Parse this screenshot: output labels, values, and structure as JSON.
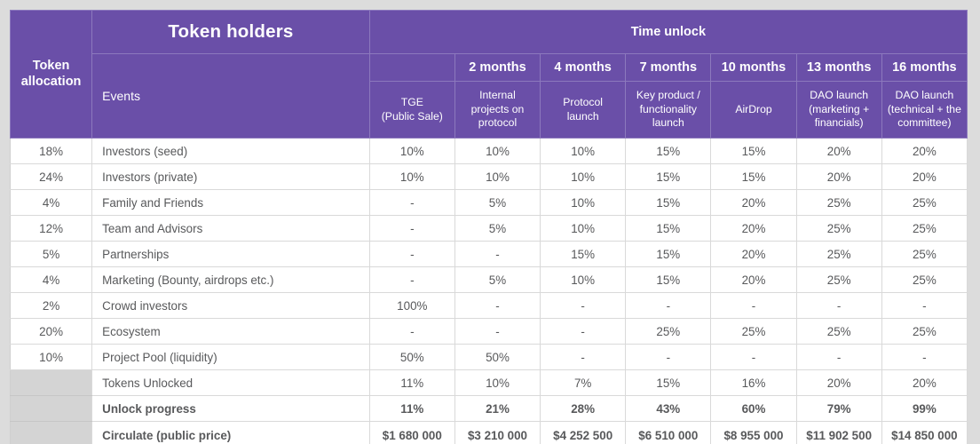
{
  "table": {
    "corner_header": "Token allocation",
    "holders_header": "Token holders",
    "events_header": "Events",
    "timeunlock_header": "Time unlock",
    "month_headers": [
      "",
      "2 months",
      "4 months",
      "7 months",
      "10 months",
      "13 months",
      "16 months"
    ],
    "event_descriptions": [
      "TGE\n(Public Sale)",
      "Internal projects on protocol",
      "Protocol launch",
      "Key product / functionality launch",
      "AirDrop",
      "DAO launch (marketing + financials)",
      "DAO launch (technical + the committee)"
    ],
    "event_desc_lines": [
      [
        "TGE",
        "(Public Sale)"
      ],
      [
        "Internal",
        "projects on",
        "protocol"
      ],
      [
        "Protocol",
        "launch"
      ],
      [
        "Key product /",
        "functionality",
        "launch"
      ],
      [
        "AirDrop"
      ],
      [
        "DAO launch",
        "(marketing +",
        "financials)"
      ],
      [
        "DAO launch",
        "(technical + the",
        "committee)"
      ]
    ],
    "rows": [
      {
        "allocation": "18%",
        "event": "Investors (seed)",
        "values": [
          "10%",
          "10%",
          "10%",
          "15%",
          "15%",
          "20%",
          "20%"
        ]
      },
      {
        "allocation": "24%",
        "event": "Investors (private)",
        "values": [
          "10%",
          "10%",
          "10%",
          "15%",
          "15%",
          "20%",
          "20%"
        ]
      },
      {
        "allocation": "4%",
        "event": "Family and Friends",
        "values": [
          "-",
          "5%",
          "10%",
          "15%",
          "20%",
          "25%",
          "25%"
        ]
      },
      {
        "allocation": "12%",
        "event": "Team and Advisors",
        "values": [
          "-",
          "5%",
          "10%",
          "15%",
          "20%",
          "25%",
          "25%"
        ]
      },
      {
        "allocation": "5%",
        "event": "Partnerships",
        "values": [
          "-",
          "-",
          "15%",
          "15%",
          "20%",
          "25%",
          "25%"
        ]
      },
      {
        "allocation": "4%",
        "event": "Marketing (Bounty, airdrops etc.)",
        "values": [
          "-",
          "5%",
          "10%",
          "15%",
          "20%",
          "25%",
          "25%"
        ]
      },
      {
        "allocation": "2%",
        "event": "Crowd investors",
        "values": [
          "100%",
          "-",
          "-",
          "-",
          "-",
          "-",
          "-"
        ]
      },
      {
        "allocation": "20%",
        "event": "Ecosystem",
        "values": [
          "-",
          "-",
          "-",
          "25%",
          "25%",
          "25%",
          "25%"
        ]
      },
      {
        "allocation": "10%",
        "event": "Project Pool (liquidity)",
        "values": [
          "50%",
          "50%",
          "-",
          "-",
          "-",
          "-",
          "-"
        ]
      }
    ],
    "summary_rows": [
      {
        "allocation": "",
        "event": "Tokens Unlocked",
        "style": "unlocked",
        "values": [
          "11%",
          "10%",
          "7%",
          "15%",
          "16%",
          "20%",
          "20%"
        ]
      },
      {
        "allocation": "",
        "event": "Unlock progress",
        "style": "progress",
        "values": [
          "11%",
          "21%",
          "28%",
          "43%",
          "60%",
          "79%",
          "99%"
        ]
      },
      {
        "allocation": "",
        "event": "Circulate (public price)",
        "style": "circulate",
        "values": [
          "$1 680 000",
          "$3 210 000",
          "$4 252 500",
          "$6 510 000",
          "$8 955 000",
          "$11 902 500",
          "$14 850 000"
        ]
      }
    ]
  },
  "colors": {
    "header_purple": "#6a4fa8",
    "header_border": "#8c79bd",
    "page_background": "#dcdcdc",
    "grey_cell": "#d4d4d4",
    "body_text": "#58595b",
    "row_border": "#d9d9d9"
  }
}
